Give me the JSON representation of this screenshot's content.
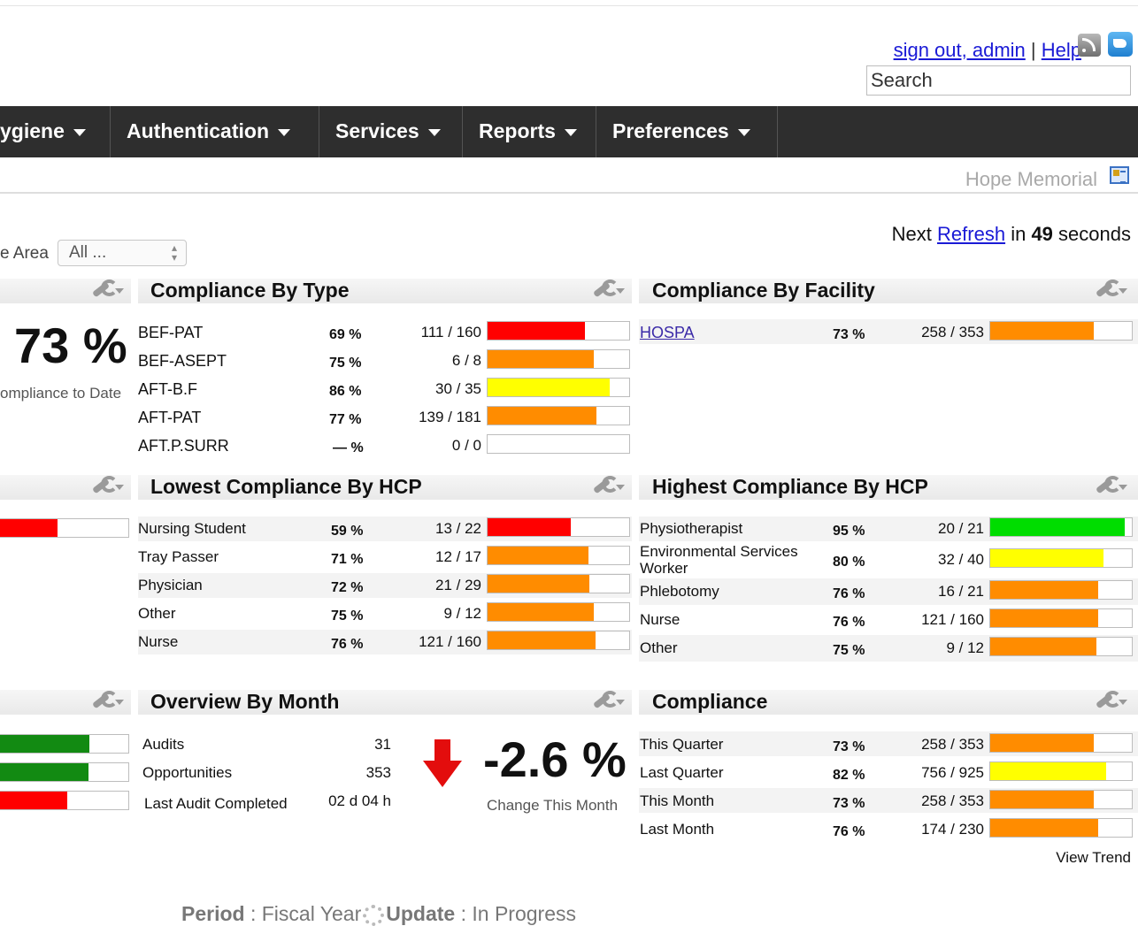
{
  "header": {
    "sign_out_label": "sign out, admin",
    "separator": "|",
    "help_label": "Help",
    "search_value": "Search",
    "rss_icon": "rss-icon",
    "twitter_icon": "twitter-icon"
  },
  "nav": {
    "items": [
      {
        "label": "ygiene"
      },
      {
        "label": "Authentication"
      },
      {
        "label": "Services"
      },
      {
        "label": "Reports"
      },
      {
        "label": "Preferences"
      }
    ]
  },
  "facility_name": "Hope Memorial",
  "refresh": {
    "prefix": "Next",
    "link": "Refresh",
    "mid": "in",
    "seconds": "49",
    "suffix": "seconds"
  },
  "filter": {
    "label": "e Area",
    "value": "All ..."
  },
  "colors": {
    "red": "#ff0000",
    "orange": "#ff8c00",
    "yellow": "#ffff00",
    "green": "#00dd00",
    "dark_green": "#128a12"
  },
  "left_column": {
    "big_value": "73 %",
    "caption": "ompliance to Date",
    "mini_bars_mid": [
      {
        "fill": 0.45,
        "color": "red"
      }
    ],
    "mini_bars_bottom": [
      {
        "fill": 0.7,
        "color": "dark_green"
      },
      {
        "fill": 0.69,
        "color": "dark_green"
      },
      {
        "fill": 0.53,
        "color": "red"
      }
    ]
  },
  "compliance_by_type": {
    "title": "Compliance By Type",
    "rows": [
      {
        "label": "BEF-PAT",
        "pct": "69 %",
        "frac": "111 / 160",
        "fill": 0.69,
        "color": "red"
      },
      {
        "label": "BEF-ASEPT",
        "pct": "75 %",
        "frac": "6 / 8",
        "fill": 0.75,
        "color": "orange"
      },
      {
        "label": "AFT-B.F",
        "pct": "86 %",
        "frac": "30 / 35",
        "fill": 0.86,
        "color": "yellow"
      },
      {
        "label": "AFT-PAT",
        "pct": "77 %",
        "frac": "139 / 181",
        "fill": 0.77,
        "color": "orange"
      },
      {
        "label": "AFT.P.SURR",
        "pct": "— %",
        "frac": "0 / 0",
        "fill": 0,
        "color": "orange"
      }
    ]
  },
  "compliance_by_facility": {
    "title": "Compliance By Facility",
    "rows": [
      {
        "label": "HOSPA",
        "pct": "73 %",
        "frac": "258 / 353",
        "fill": 0.73,
        "color": "orange"
      }
    ]
  },
  "lowest_by_hcp": {
    "title": "Lowest Compliance By HCP",
    "rows": [
      {
        "label": "Nursing Student",
        "pct": "59 %",
        "frac": "13 / 22",
        "fill": 0.59,
        "color": "red"
      },
      {
        "label": "Tray Passer",
        "pct": "71 %",
        "frac": "12 / 17",
        "fill": 0.71,
        "color": "orange"
      },
      {
        "label": "Physician",
        "pct": "72 %",
        "frac": "21 / 29",
        "fill": 0.72,
        "color": "orange"
      },
      {
        "label": "Other",
        "pct": "75 %",
        "frac": "9 / 12",
        "fill": 0.75,
        "color": "orange"
      },
      {
        "label": "Nurse",
        "pct": "76 %",
        "frac": "121 / 160",
        "fill": 0.76,
        "color": "orange"
      }
    ]
  },
  "highest_by_hcp": {
    "title": "Highest Compliance By HCP",
    "rows": [
      {
        "label": "Physiotherapist",
        "pct": "95 %",
        "frac": "20 / 21",
        "fill": 0.95,
        "color": "green"
      },
      {
        "label": "Environmental Services Worker",
        "pct": "80 %",
        "frac": "32 / 40",
        "fill": 0.8,
        "color": "yellow"
      },
      {
        "label": "Phlebotomy",
        "pct": "76 %",
        "frac": "16 / 21",
        "fill": 0.76,
        "color": "orange"
      },
      {
        "label": "Nurse",
        "pct": "76 %",
        "frac": "121 / 160",
        "fill": 0.76,
        "color": "orange"
      },
      {
        "label": "Other",
        "pct": "75 %",
        "frac": "9 / 12",
        "fill": 0.75,
        "color": "orange"
      }
    ]
  },
  "overview_by_month": {
    "title": "Overview By Month",
    "rows": [
      {
        "label": "Audits",
        "value": "31"
      },
      {
        "label": "Opportunities",
        "value": "353"
      },
      {
        "label": "Last Audit Completed",
        "value": "02 d 04 h"
      }
    ],
    "change_value": "-2.6 %",
    "change_caption": "Change This Month",
    "change_icon": "down-arrow-icon"
  },
  "compliance": {
    "title": "Compliance",
    "rows": [
      {
        "label": "This Quarter",
        "pct": "73 %",
        "frac": "258 / 353",
        "fill": 0.73,
        "color": "orange"
      },
      {
        "label": "Last Quarter",
        "pct": "82 %",
        "frac": "756 / 925",
        "fill": 0.82,
        "color": "yellow"
      },
      {
        "label": "This Month",
        "pct": "73 %",
        "frac": "258 / 353",
        "fill": 0.73,
        "color": "orange"
      },
      {
        "label": "Last Month",
        "pct": "76 %",
        "frac": "174 / 230",
        "fill": 0.76,
        "color": "orange"
      }
    ],
    "view_trend": "View Trend"
  },
  "footer": {
    "period_label": "Period",
    "sep": ":",
    "period_value": "Fiscal Year",
    "update_label": "Update",
    "update_value": "In Progress"
  }
}
